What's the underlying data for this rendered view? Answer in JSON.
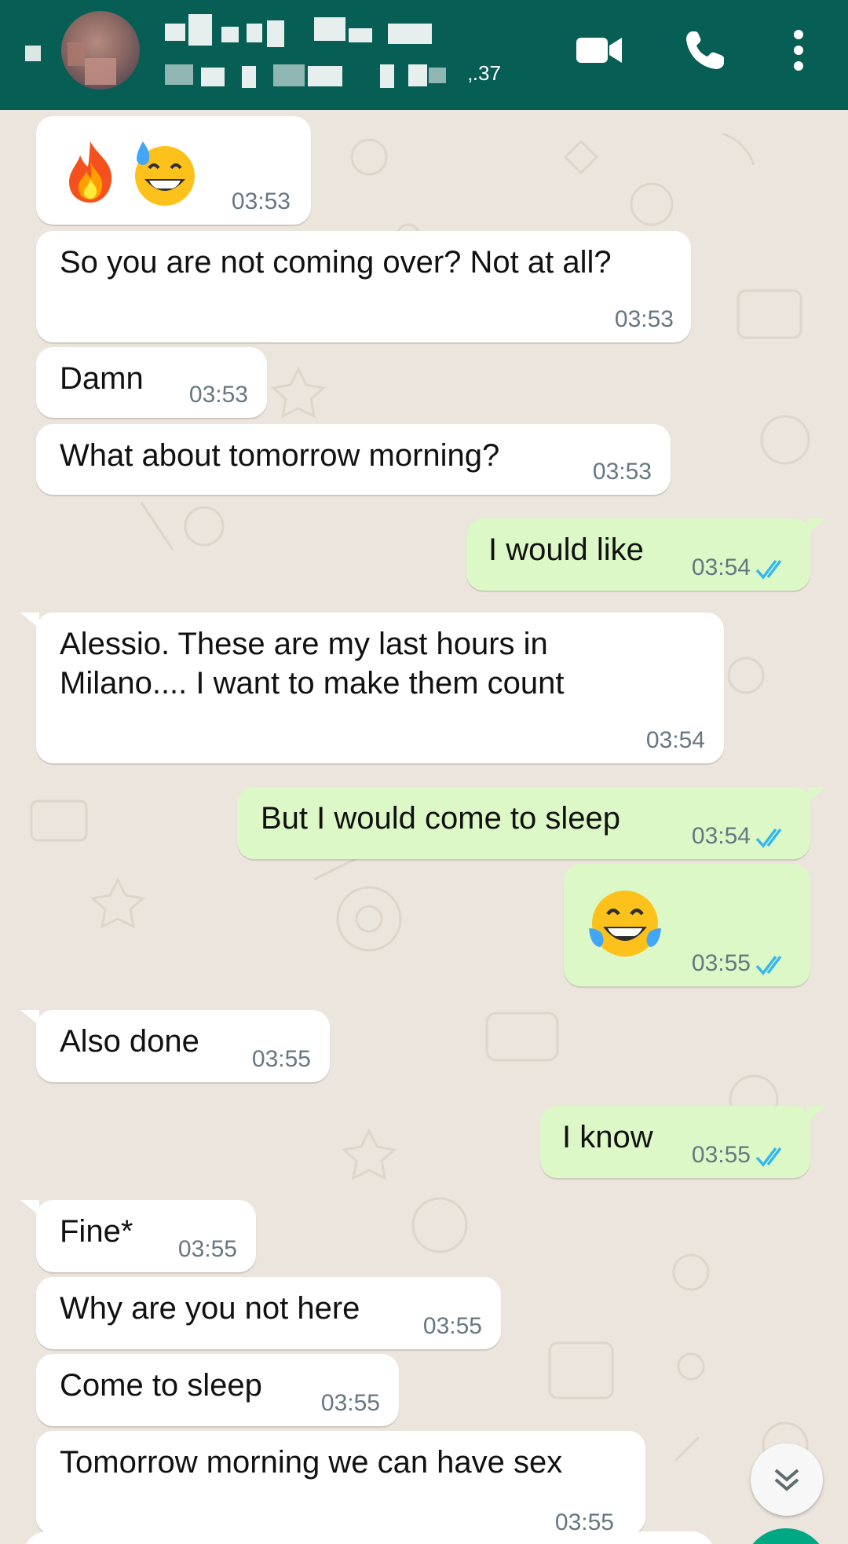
{
  "header": {
    "contact_name": "",
    "status_fragment": "‚.37",
    "icons": [
      "back-icon",
      "avatar",
      "video-call-icon",
      "phone-icon",
      "more-vertical-icon"
    ],
    "background_color": "#075e54"
  },
  "messages": [
    {
      "direction": "in",
      "text": "",
      "emoji": "fire + grinning sweat",
      "time": "03:53"
    },
    {
      "direction": "in",
      "text": "So you are not coming over? Not at all?",
      "time": "03:53"
    },
    {
      "direction": "in",
      "text": "Damn",
      "time": "03:53"
    },
    {
      "direction": "in",
      "text": "What about tomorrow morning?",
      "time": "03:53"
    },
    {
      "direction": "out",
      "text": "I would like",
      "time": "03:54",
      "read": true
    },
    {
      "direction": "in",
      "text_line1": "Alessio. These are my last hours in",
      "text_line2": "Milano.... I want to make them count",
      "time": "03:54"
    },
    {
      "direction": "out",
      "text": "But I would come to sleep",
      "time": "03:54",
      "read": true
    },
    {
      "direction": "out",
      "text": "",
      "emoji": "tears of joy",
      "time": "03:55",
      "read": true
    },
    {
      "direction": "in",
      "text": "Also done",
      "time": "03:55"
    },
    {
      "direction": "out",
      "text": "I know",
      "time": "03:55",
      "read": true
    },
    {
      "direction": "in",
      "text": "Fine*",
      "time": "03:55"
    },
    {
      "direction": "in",
      "text": "Why are you not here",
      "time": "03:55"
    },
    {
      "direction": "in",
      "text": "Come to sleep",
      "time": "03:55"
    },
    {
      "direction": "in",
      "text": "Tomorrow morning we can have sex",
      "time": "03:55"
    }
  ],
  "colors": {
    "wallpaper": "#ece5dd",
    "incoming_bubble": "#ffffff",
    "outgoing_bubble": "#dcf8c6",
    "read_ticks": "#34b7f1",
    "timestamp": "#667781"
  }
}
